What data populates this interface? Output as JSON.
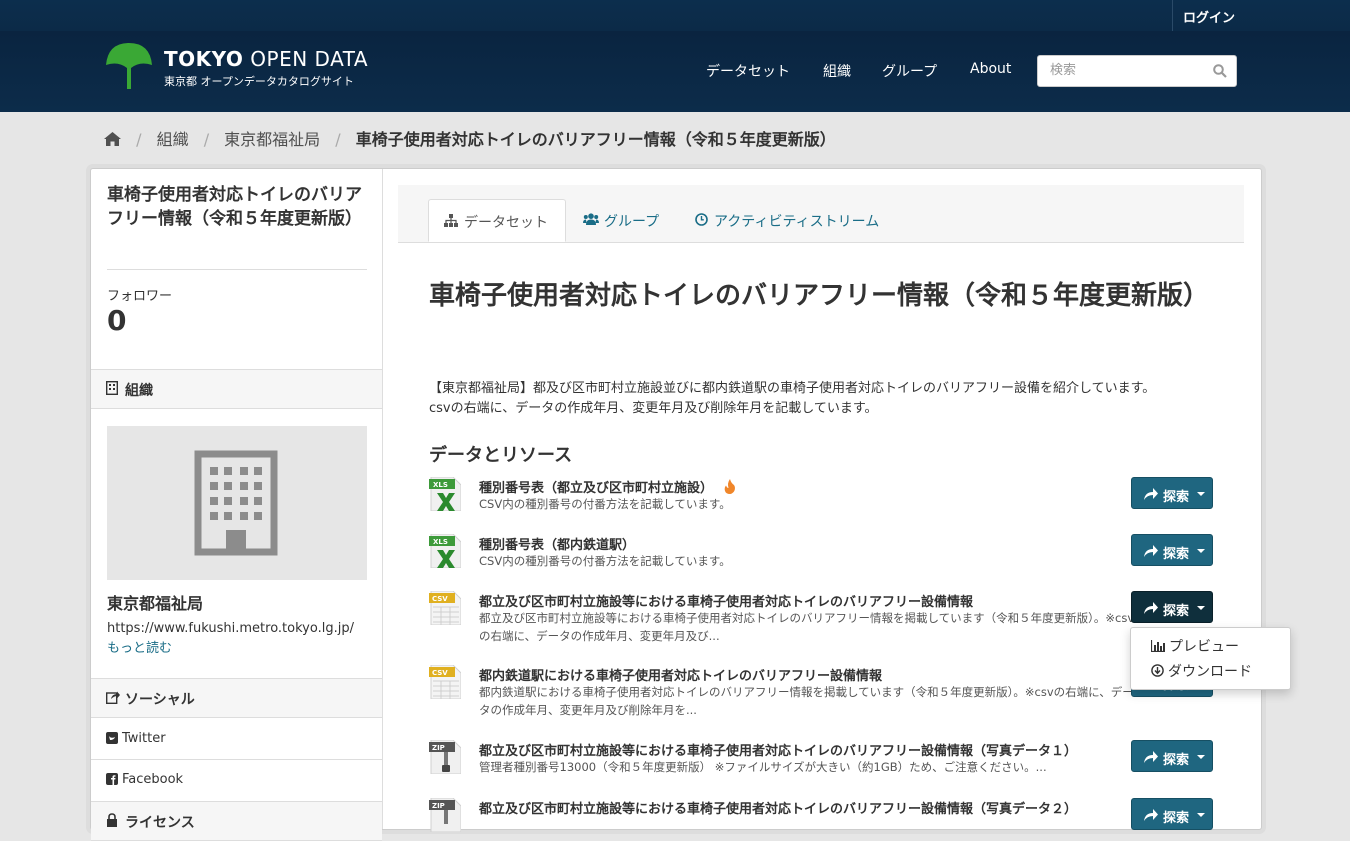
{
  "account": {
    "login": "ログイン"
  },
  "site": {
    "title_bold": "TOKYO",
    "title_rest": "OPEN DATA",
    "subtitle": "東京都 オープンデータカタログサイト",
    "brand_green": "#3aa835"
  },
  "nav": {
    "items": [
      "データセット",
      "組織",
      "グループ",
      "About"
    ]
  },
  "search": {
    "placeholder": "検索"
  },
  "breadcrumb": {
    "items": [
      "組織",
      "東京都福祉局",
      "車椅子使用者対応トイレのバリアフリー情報（令和５年度更新版）"
    ]
  },
  "sidebar": {
    "title": "車椅子使用者対応トイレのバリアフリー情報（令和５年度更新版）",
    "followers_label": "フォロワー",
    "followers_count": "0",
    "org_heading": "組織",
    "org_name": "東京都福祉局",
    "org_url": "https://www.fukushi.metro.tokyo.lg.jp/",
    "read_more": "もっと読む",
    "social_heading": "ソーシャル",
    "social": [
      "Twitter",
      "Facebook"
    ],
    "license_heading": "ライセンス"
  },
  "tabs": [
    {
      "label": "データセット",
      "icon": "sitemap-icon",
      "active": true
    },
    {
      "label": "グループ",
      "icon": "users-icon",
      "active": false
    },
    {
      "label": "アクティビティストリーム",
      "icon": "clock-icon",
      "active": false
    }
  ],
  "main": {
    "title": "車椅子使用者対応トイレのバリアフリー情報（令和５年度更新版）",
    "notes_1": "【東京都福祉局】都及び区市町村立施設並びに都内鉄道駅の車椅子使用者対応トイレのバリアフリー設備を紹介しています。",
    "notes_2": "csvの右端に、データの作成年月、変更年月及び削除年月を記載しています。",
    "resources_heading": "データとリソース"
  },
  "resources": [
    {
      "format": "XLS",
      "title": "種別番号表（都立及び区市町村立施設）",
      "desc": "CSV内の種別番号の付番方法を記載しています。",
      "popular": true
    },
    {
      "format": "XLS",
      "title": "種別番号表（都内鉄道駅）",
      "desc": "CSV内の種別番号の付番方法を記載しています。",
      "popular": false
    },
    {
      "format": "CSV",
      "title": "都立及び区市町村立施設等における車椅子使用者対応トイレのバリアフリー設備情報",
      "desc": "都立及び区市町村立施設等における車椅子使用者対応トイレのバリアフリー情報を掲載しています（令和５年度更新版）。※csvの右端に、データの作成年月、変更年月及び...",
      "popular": false
    },
    {
      "format": "CSV",
      "title": "都内鉄道駅における車椅子使用者対応トイレのバリアフリー設備情報",
      "desc": "都内鉄道駅における車椅子使用者対応トイレのバリアフリー情報を掲載しています（令和５年度更新版）。※csvの右端に、データの作成年月、変更年月及び削除年月を...",
      "popular": false
    },
    {
      "format": "ZIP",
      "title": "都立及び区市町村立施設等における車椅子使用者対応トイレのバリアフリー設備情報（写真データ１）",
      "desc": "管理者種別番号13000（令和５年度更新版） ※ファイルサイズが大きい（約1GB）ため、ご注意ください。...",
      "popular": false
    },
    {
      "format": "ZIP",
      "title": "都立及び区市町村立施設等における車椅子使用者対応トイレのバリアフリー設備情報（写真データ２）",
      "desc": "",
      "popular": false
    }
  ],
  "explore_label": "探索",
  "dropdown": {
    "preview": "プレビュー",
    "download": "ダウンロード"
  }
}
